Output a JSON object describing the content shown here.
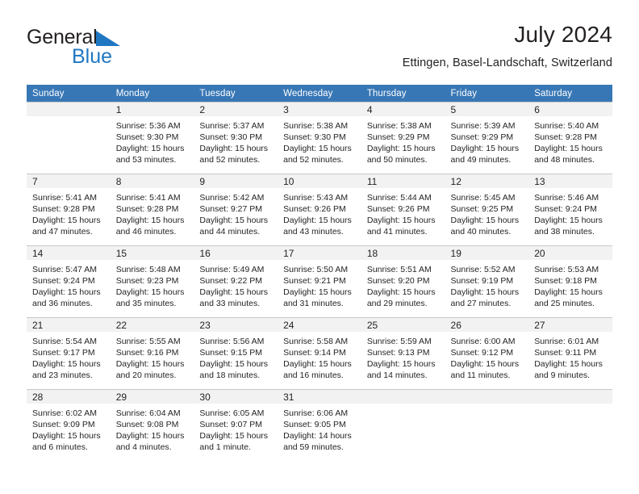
{
  "brand": {
    "name_part1": "General",
    "name_part2": "Blue",
    "triangle_color": "#1f77c2",
    "text_color": "#231f20"
  },
  "header": {
    "title": "July 2024",
    "location": "Ettingen, Basel-Landschaft, Switzerland"
  },
  "theme": {
    "header_bg": "#3877b5",
    "header_text": "#ffffff",
    "daynum_bg": "#f2f2f2",
    "grid_line": "#c8c8c8",
    "body_text": "#231f20"
  },
  "weekdays": [
    "Sunday",
    "Monday",
    "Tuesday",
    "Wednesday",
    "Thursday",
    "Friday",
    "Saturday"
  ],
  "weeks": [
    [
      {
        "day": "",
        "sunrise": "",
        "sunset": "",
        "daylight1": "",
        "daylight2": ""
      },
      {
        "day": "1",
        "sunrise": "Sunrise: 5:36 AM",
        "sunset": "Sunset: 9:30 PM",
        "daylight1": "Daylight: 15 hours",
        "daylight2": "and 53 minutes."
      },
      {
        "day": "2",
        "sunrise": "Sunrise: 5:37 AM",
        "sunset": "Sunset: 9:30 PM",
        "daylight1": "Daylight: 15 hours",
        "daylight2": "and 52 minutes."
      },
      {
        "day": "3",
        "sunrise": "Sunrise: 5:38 AM",
        "sunset": "Sunset: 9:30 PM",
        "daylight1": "Daylight: 15 hours",
        "daylight2": "and 52 minutes."
      },
      {
        "day": "4",
        "sunrise": "Sunrise: 5:38 AM",
        "sunset": "Sunset: 9:29 PM",
        "daylight1": "Daylight: 15 hours",
        "daylight2": "and 50 minutes."
      },
      {
        "day": "5",
        "sunrise": "Sunrise: 5:39 AM",
        "sunset": "Sunset: 9:29 PM",
        "daylight1": "Daylight: 15 hours",
        "daylight2": "and 49 minutes."
      },
      {
        "day": "6",
        "sunrise": "Sunrise: 5:40 AM",
        "sunset": "Sunset: 9:28 PM",
        "daylight1": "Daylight: 15 hours",
        "daylight2": "and 48 minutes."
      }
    ],
    [
      {
        "day": "7",
        "sunrise": "Sunrise: 5:41 AM",
        "sunset": "Sunset: 9:28 PM",
        "daylight1": "Daylight: 15 hours",
        "daylight2": "and 47 minutes."
      },
      {
        "day": "8",
        "sunrise": "Sunrise: 5:41 AM",
        "sunset": "Sunset: 9:28 PM",
        "daylight1": "Daylight: 15 hours",
        "daylight2": "and 46 minutes."
      },
      {
        "day": "9",
        "sunrise": "Sunrise: 5:42 AM",
        "sunset": "Sunset: 9:27 PM",
        "daylight1": "Daylight: 15 hours",
        "daylight2": "and 44 minutes."
      },
      {
        "day": "10",
        "sunrise": "Sunrise: 5:43 AM",
        "sunset": "Sunset: 9:26 PM",
        "daylight1": "Daylight: 15 hours",
        "daylight2": "and 43 minutes."
      },
      {
        "day": "11",
        "sunrise": "Sunrise: 5:44 AM",
        "sunset": "Sunset: 9:26 PM",
        "daylight1": "Daylight: 15 hours",
        "daylight2": "and 41 minutes."
      },
      {
        "day": "12",
        "sunrise": "Sunrise: 5:45 AM",
        "sunset": "Sunset: 9:25 PM",
        "daylight1": "Daylight: 15 hours",
        "daylight2": "and 40 minutes."
      },
      {
        "day": "13",
        "sunrise": "Sunrise: 5:46 AM",
        "sunset": "Sunset: 9:24 PM",
        "daylight1": "Daylight: 15 hours",
        "daylight2": "and 38 minutes."
      }
    ],
    [
      {
        "day": "14",
        "sunrise": "Sunrise: 5:47 AM",
        "sunset": "Sunset: 9:24 PM",
        "daylight1": "Daylight: 15 hours",
        "daylight2": "and 36 minutes."
      },
      {
        "day": "15",
        "sunrise": "Sunrise: 5:48 AM",
        "sunset": "Sunset: 9:23 PM",
        "daylight1": "Daylight: 15 hours",
        "daylight2": "and 35 minutes."
      },
      {
        "day": "16",
        "sunrise": "Sunrise: 5:49 AM",
        "sunset": "Sunset: 9:22 PM",
        "daylight1": "Daylight: 15 hours",
        "daylight2": "and 33 minutes."
      },
      {
        "day": "17",
        "sunrise": "Sunrise: 5:50 AM",
        "sunset": "Sunset: 9:21 PM",
        "daylight1": "Daylight: 15 hours",
        "daylight2": "and 31 minutes."
      },
      {
        "day": "18",
        "sunrise": "Sunrise: 5:51 AM",
        "sunset": "Sunset: 9:20 PM",
        "daylight1": "Daylight: 15 hours",
        "daylight2": "and 29 minutes."
      },
      {
        "day": "19",
        "sunrise": "Sunrise: 5:52 AM",
        "sunset": "Sunset: 9:19 PM",
        "daylight1": "Daylight: 15 hours",
        "daylight2": "and 27 minutes."
      },
      {
        "day": "20",
        "sunrise": "Sunrise: 5:53 AM",
        "sunset": "Sunset: 9:18 PM",
        "daylight1": "Daylight: 15 hours",
        "daylight2": "and 25 minutes."
      }
    ],
    [
      {
        "day": "21",
        "sunrise": "Sunrise: 5:54 AM",
        "sunset": "Sunset: 9:17 PM",
        "daylight1": "Daylight: 15 hours",
        "daylight2": "and 23 minutes."
      },
      {
        "day": "22",
        "sunrise": "Sunrise: 5:55 AM",
        "sunset": "Sunset: 9:16 PM",
        "daylight1": "Daylight: 15 hours",
        "daylight2": "and 20 minutes."
      },
      {
        "day": "23",
        "sunrise": "Sunrise: 5:56 AM",
        "sunset": "Sunset: 9:15 PM",
        "daylight1": "Daylight: 15 hours",
        "daylight2": "and 18 minutes."
      },
      {
        "day": "24",
        "sunrise": "Sunrise: 5:58 AM",
        "sunset": "Sunset: 9:14 PM",
        "daylight1": "Daylight: 15 hours",
        "daylight2": "and 16 minutes."
      },
      {
        "day": "25",
        "sunrise": "Sunrise: 5:59 AM",
        "sunset": "Sunset: 9:13 PM",
        "daylight1": "Daylight: 15 hours",
        "daylight2": "and 14 minutes."
      },
      {
        "day": "26",
        "sunrise": "Sunrise: 6:00 AM",
        "sunset": "Sunset: 9:12 PM",
        "daylight1": "Daylight: 15 hours",
        "daylight2": "and 11 minutes."
      },
      {
        "day": "27",
        "sunrise": "Sunrise: 6:01 AM",
        "sunset": "Sunset: 9:11 PM",
        "daylight1": "Daylight: 15 hours",
        "daylight2": "and 9 minutes."
      }
    ],
    [
      {
        "day": "28",
        "sunrise": "Sunrise: 6:02 AM",
        "sunset": "Sunset: 9:09 PM",
        "daylight1": "Daylight: 15 hours",
        "daylight2": "and 6 minutes."
      },
      {
        "day": "29",
        "sunrise": "Sunrise: 6:04 AM",
        "sunset": "Sunset: 9:08 PM",
        "daylight1": "Daylight: 15 hours",
        "daylight2": "and 4 minutes."
      },
      {
        "day": "30",
        "sunrise": "Sunrise: 6:05 AM",
        "sunset": "Sunset: 9:07 PM",
        "daylight1": "Daylight: 15 hours",
        "daylight2": "and 1 minute."
      },
      {
        "day": "31",
        "sunrise": "Sunrise: 6:06 AM",
        "sunset": "Sunset: 9:05 PM",
        "daylight1": "Daylight: 14 hours",
        "daylight2": "and 59 minutes."
      },
      {
        "day": "",
        "sunrise": "",
        "sunset": "",
        "daylight1": "",
        "daylight2": ""
      },
      {
        "day": "",
        "sunrise": "",
        "sunset": "",
        "daylight1": "",
        "daylight2": ""
      },
      {
        "day": "",
        "sunrise": "",
        "sunset": "",
        "daylight1": "",
        "daylight2": ""
      }
    ]
  ]
}
